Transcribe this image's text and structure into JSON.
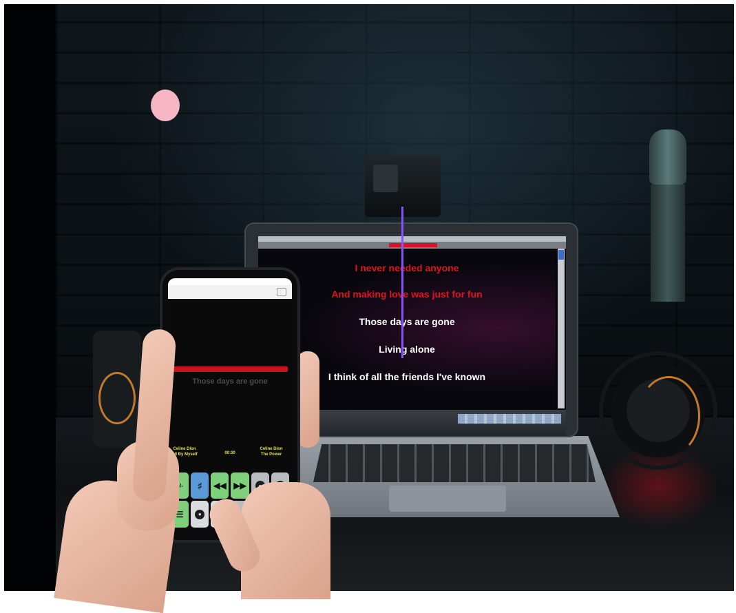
{
  "laptop": {
    "lyrics": [
      {
        "text": "I never needed anyone",
        "style": "sung"
      },
      {
        "text": "And making love was just for fun",
        "style": "sung"
      },
      {
        "text": "Those days are gone",
        "style": "upcoming"
      },
      {
        "text": "Living alone",
        "style": "upcoming"
      },
      {
        "text": "I think of all the friends I've known",
        "style": "upcoming"
      }
    ]
  },
  "phone": {
    "current_lyric": "Those days are gone",
    "prev_song": "Celine Dion All By Myself",
    "elapsed_time": "00:30",
    "next_song": "Celine Dion The Power",
    "buttons_row1": [
      "+/-",
      "key-icon",
      "rewind-icon",
      "fast-forward-icon",
      "circle-icon",
      "minus-circle-icon"
    ],
    "buttons_row2": [
      "list-icon",
      "record-icon",
      "stop-icon",
      "shuffle-icon",
      "skip-icon",
      ""
    ],
    "colors": {
      "button_green": "#7fd07a",
      "button_blue": "#5a9ad8",
      "sung_lyric": "#e3121f"
    }
  },
  "scene": {
    "accent_colors": {
      "pink_dot": "#f6b6c4",
      "cursor_line": "#8a52ff"
    }
  }
}
